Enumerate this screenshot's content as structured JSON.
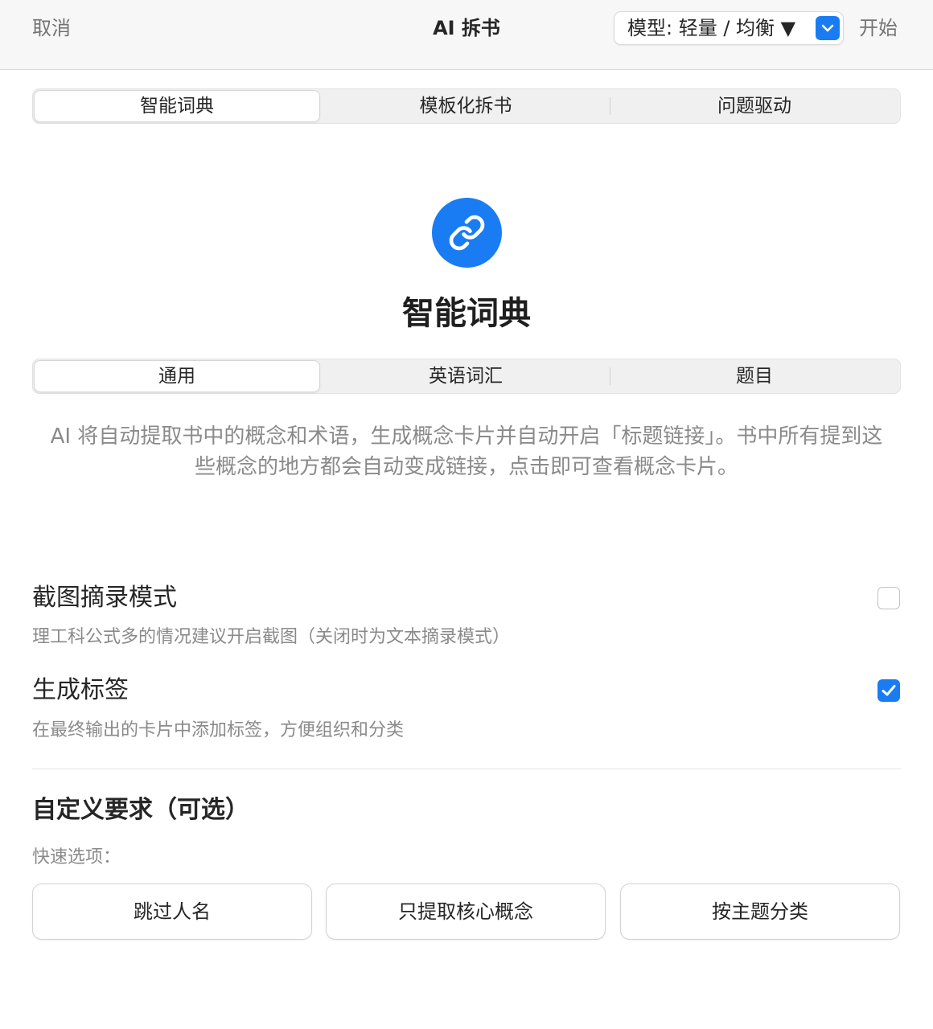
{
  "header": {
    "cancel_label": "取消",
    "title": "AI 拆书",
    "model_select_value": "模型: 轻量 / 均衡 ▼",
    "start_label": "开始"
  },
  "mode_tabs": [
    {
      "label": "智能词典",
      "active": true
    },
    {
      "label": "模板化拆书",
      "active": false
    },
    {
      "label": "问题驱动",
      "active": false
    }
  ],
  "feature": {
    "icon": "link-icon",
    "title": "智能词典"
  },
  "sub_tabs": [
    {
      "label": "通用",
      "active": true
    },
    {
      "label": "英语词汇",
      "active": false
    },
    {
      "label": "题目",
      "active": false
    }
  ],
  "description": "AI 将自动提取书中的概念和术语，生成概念卡片并自动开启「标题链接」。书中所有提到这些概念的地方都会自动变成链接，点击即可查看概念卡片。",
  "options": [
    {
      "title": "截图摘录模式",
      "description": "理工科公式多的情况建议开启截图（关闭时为文本摘录模式）",
      "checked": false
    },
    {
      "title": "生成标签",
      "description": "在最终输出的卡片中添加标签，方便组织和分类",
      "checked": true
    }
  ],
  "custom": {
    "title": "自定义要求（可选）",
    "quick_label": "快速选项：",
    "quick_options": [
      "跳过人名",
      "只提取核心概念",
      "按主题分类"
    ]
  },
  "colors": {
    "accent": "#1a7cf2",
    "muted_text": "#8a8a8a"
  }
}
